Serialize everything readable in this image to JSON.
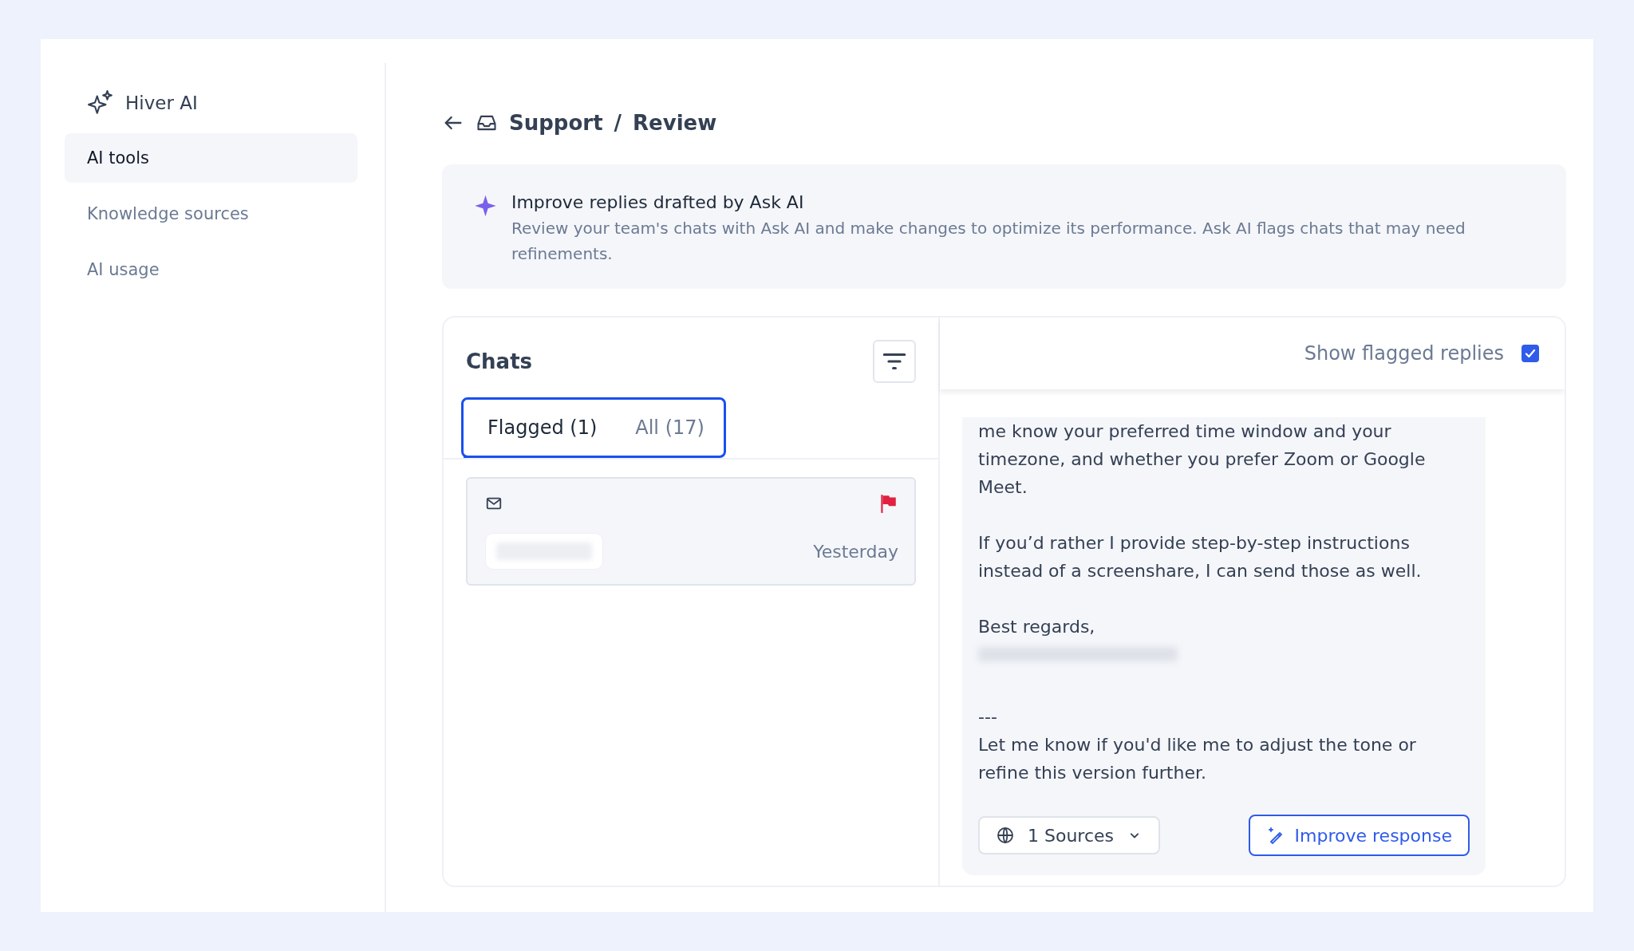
{
  "sidebar": {
    "title": "Hiver AI",
    "items": [
      {
        "label": "AI tools",
        "selected": true
      },
      {
        "label": "Knowledge sources",
        "selected": false
      },
      {
        "label": "AI usage",
        "selected": false
      }
    ]
  },
  "breadcrumb": [
    "Support",
    "Review"
  ],
  "breadcrumb_separator": "/",
  "banner": {
    "title": "Improve replies drafted by Ask AI",
    "text": "Review your team's chats with Ask AI and make changes to optimize its performance. Ask AI flags chats that may need refinements."
  },
  "chats": {
    "title": "Chats",
    "tabs": [
      {
        "label": "Flagged (1)",
        "selected": true
      },
      {
        "label": "All (17)",
        "selected": false
      }
    ],
    "items": [
      {
        "flagged": true,
        "time": "Yesterday"
      }
    ]
  },
  "reply": {
    "show_flagged": {
      "label": "Show flagged replies",
      "checked": true
    },
    "paragraphs": [
      "me know your preferred time window and your timezone, and whether you prefer Zoom or Google Meet.",
      "If you’d rather I provide step-by-step instructions instead of a screenshare, I can send those as well.",
      "Best regards,",
      "---",
      "Let me know if you'd like me to adjust the tone or refine this version further."
    ],
    "sources_label": "1 Sources",
    "improve_label": "Improve response"
  }
}
